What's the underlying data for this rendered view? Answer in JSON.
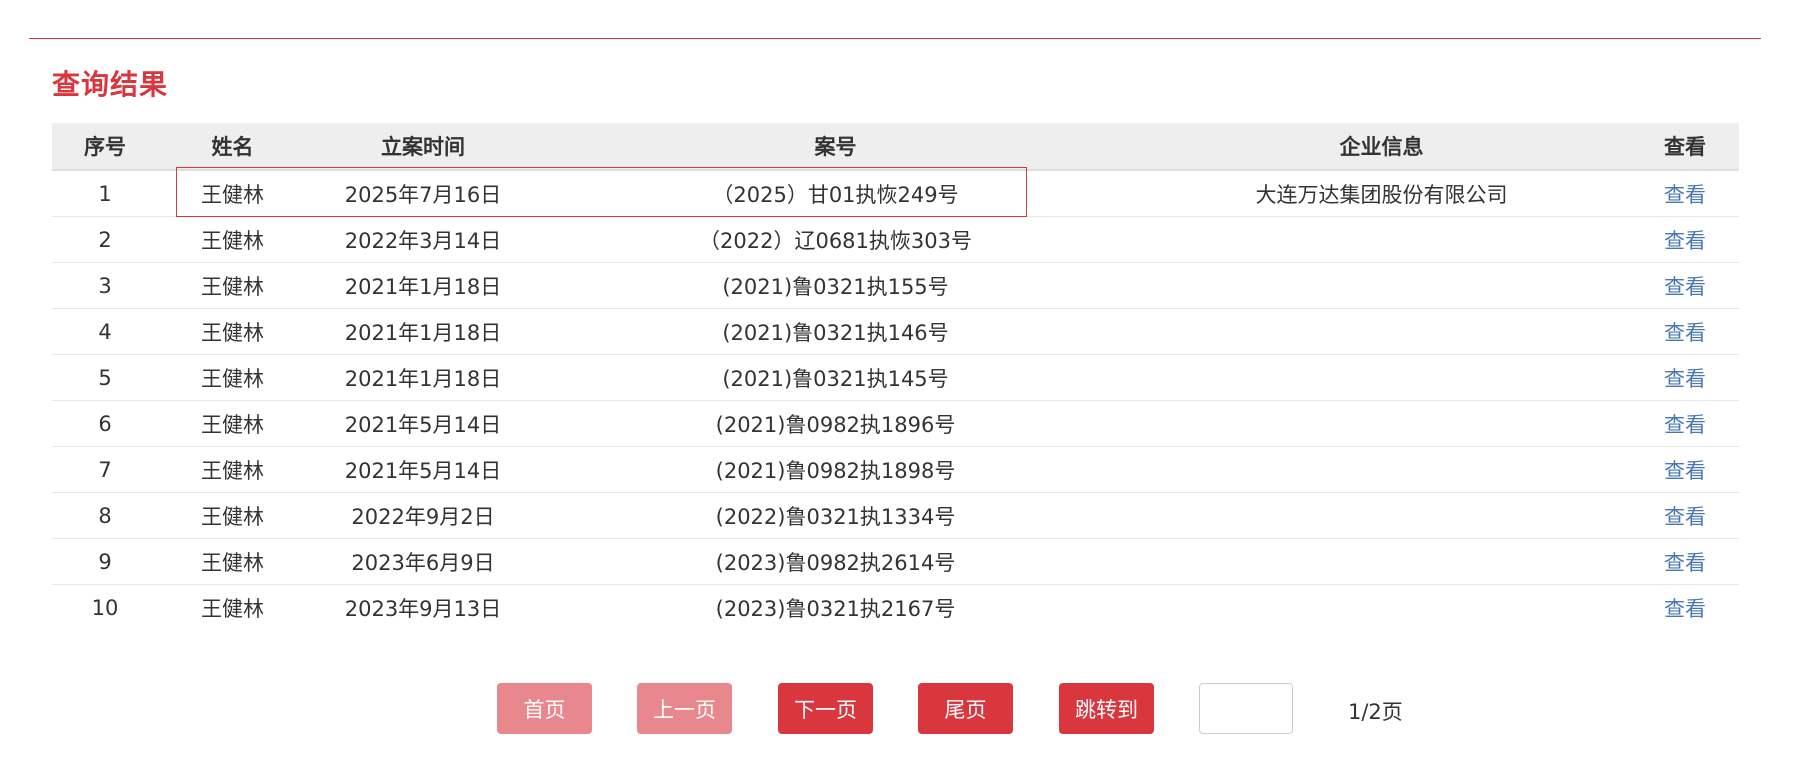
{
  "section_title": "查询结果",
  "table": {
    "columns": [
      "序号",
      "姓名",
      "立案时间",
      "案号",
      "企业信息",
      "查看"
    ],
    "rows": [
      {
        "no": "1",
        "name": "王健林",
        "date": "2025年7月16日",
        "case_no": "（2025）甘01执恢249号",
        "company": "大连万达集团股份有限公司",
        "view": "查看"
      },
      {
        "no": "2",
        "name": "王健林",
        "date": "2022年3月14日",
        "case_no": "（2022）辽0681执恢303号",
        "company": "",
        "view": "查看"
      },
      {
        "no": "3",
        "name": "王健林",
        "date": "2021年1月18日",
        "case_no": "(2021)鲁0321执155号",
        "company": "",
        "view": "查看"
      },
      {
        "no": "4",
        "name": "王健林",
        "date": "2021年1月18日",
        "case_no": "(2021)鲁0321执146号",
        "company": "",
        "view": "查看"
      },
      {
        "no": "5",
        "name": "王健林",
        "date": "2021年1月18日",
        "case_no": "(2021)鲁0321执145号",
        "company": "",
        "view": "查看"
      },
      {
        "no": "6",
        "name": "王健林",
        "date": "2021年5月14日",
        "case_no": "(2021)鲁0982执1896号",
        "company": "",
        "view": "查看"
      },
      {
        "no": "7",
        "name": "王健林",
        "date": "2021年5月14日",
        "case_no": "(2021)鲁0982执1898号",
        "company": "",
        "view": "查看"
      },
      {
        "no": "8",
        "name": "王健林",
        "date": "2022年9月2日",
        "case_no": "(2022)鲁0321执1334号",
        "company": "",
        "view": "查看"
      },
      {
        "no": "9",
        "name": "王健林",
        "date": "2023年6月9日",
        "case_no": "(2023)鲁0982执2614号",
        "company": "",
        "view": "查看"
      },
      {
        "no": "10",
        "name": "王健林",
        "date": "2023年9月13日",
        "case_no": "(2023)鲁0321执2167号",
        "company": "",
        "view": "查看"
      }
    ]
  },
  "pagination": {
    "first": "首页",
    "prev": "上一页",
    "next": "下一页",
    "last": "尾页",
    "jump": "跳转到",
    "jump_input_value": "",
    "page_count": "1/2页"
  },
  "colors": {
    "accent": "#d9363e",
    "accent_disabled": "#e8878c",
    "link": "#4a78b0",
    "header_bg": "#eeeeee"
  }
}
